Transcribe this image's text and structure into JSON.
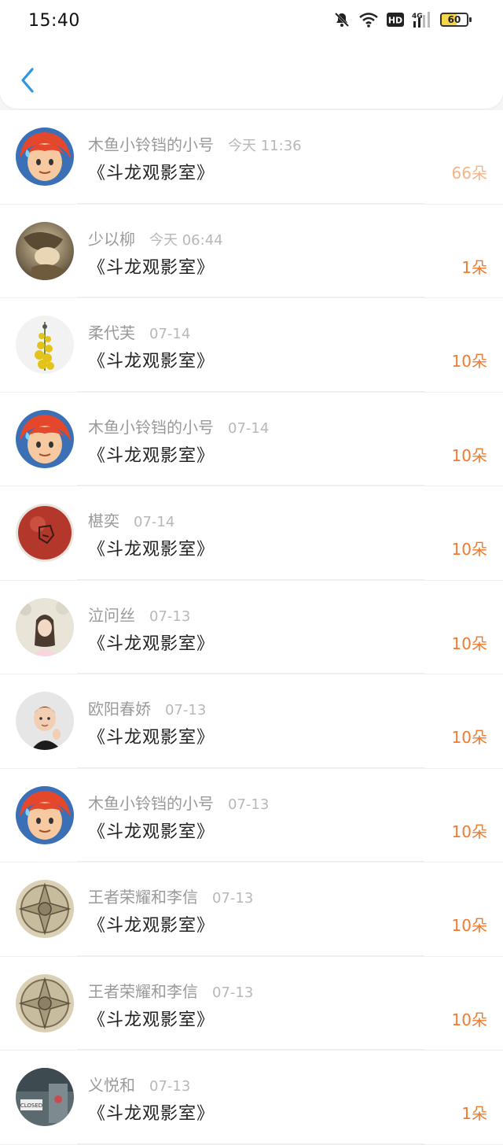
{
  "status_bar": {
    "time": "15:40",
    "network": "4G",
    "hd": "HD",
    "battery": "60"
  },
  "header": {
    "back_icon": "chevron-left-icon",
    "accent": "#2c97de"
  },
  "items": [
    {
      "user": "木鱼小铃铛的小号",
      "time": "今天 11:36",
      "title": "《斗龙观影室》",
      "amount": "66朵",
      "avatar": "red-hair-character",
      "amount_style": "light"
    },
    {
      "user": "少以柳",
      "time": "今天 06:44",
      "title": "《斗龙观影室》",
      "amount": "1朵",
      "avatar": "sepia-portrait"
    },
    {
      "user": "柔代芙",
      "time": "07-14",
      "title": "《斗龙观影室》",
      "amount": "10朵",
      "avatar": "yellow-flowers"
    },
    {
      "user": "木鱼小铃铛的小号",
      "time": "07-14",
      "title": "《斗龙观影室》",
      "amount": "10朵",
      "avatar": "red-hair-character"
    },
    {
      "user": "椹奕",
      "time": "07-14",
      "title": "《斗龙观影室》",
      "amount": "10朵",
      "avatar": "red-ball"
    },
    {
      "user": "泣问丝",
      "time": "07-13",
      "title": "《斗龙观影室》",
      "amount": "10朵",
      "avatar": "girl-photo"
    },
    {
      "user": "欧阳春娇",
      "time": "07-13",
      "title": "《斗龙观影室》",
      "amount": "10朵",
      "avatar": "boy-photo"
    },
    {
      "user": "木鱼小铃铛的小号",
      "time": "07-13",
      "title": "《斗龙观影室》",
      "amount": "10朵",
      "avatar": "red-hair-character"
    },
    {
      "user": "王者荣耀和李信",
      "time": "07-13",
      "title": "《斗龙观影室》",
      "amount": "10朵",
      "avatar": "emblem"
    },
    {
      "user": "王者荣耀和李信",
      "time": "07-13",
      "title": "《斗龙观影室》",
      "amount": "10朵",
      "avatar": "emblem"
    },
    {
      "user": "义悦和",
      "time": "07-13",
      "title": "《斗龙观影室》",
      "amount": "1朵",
      "avatar": "closed-sign-photo"
    }
  ]
}
